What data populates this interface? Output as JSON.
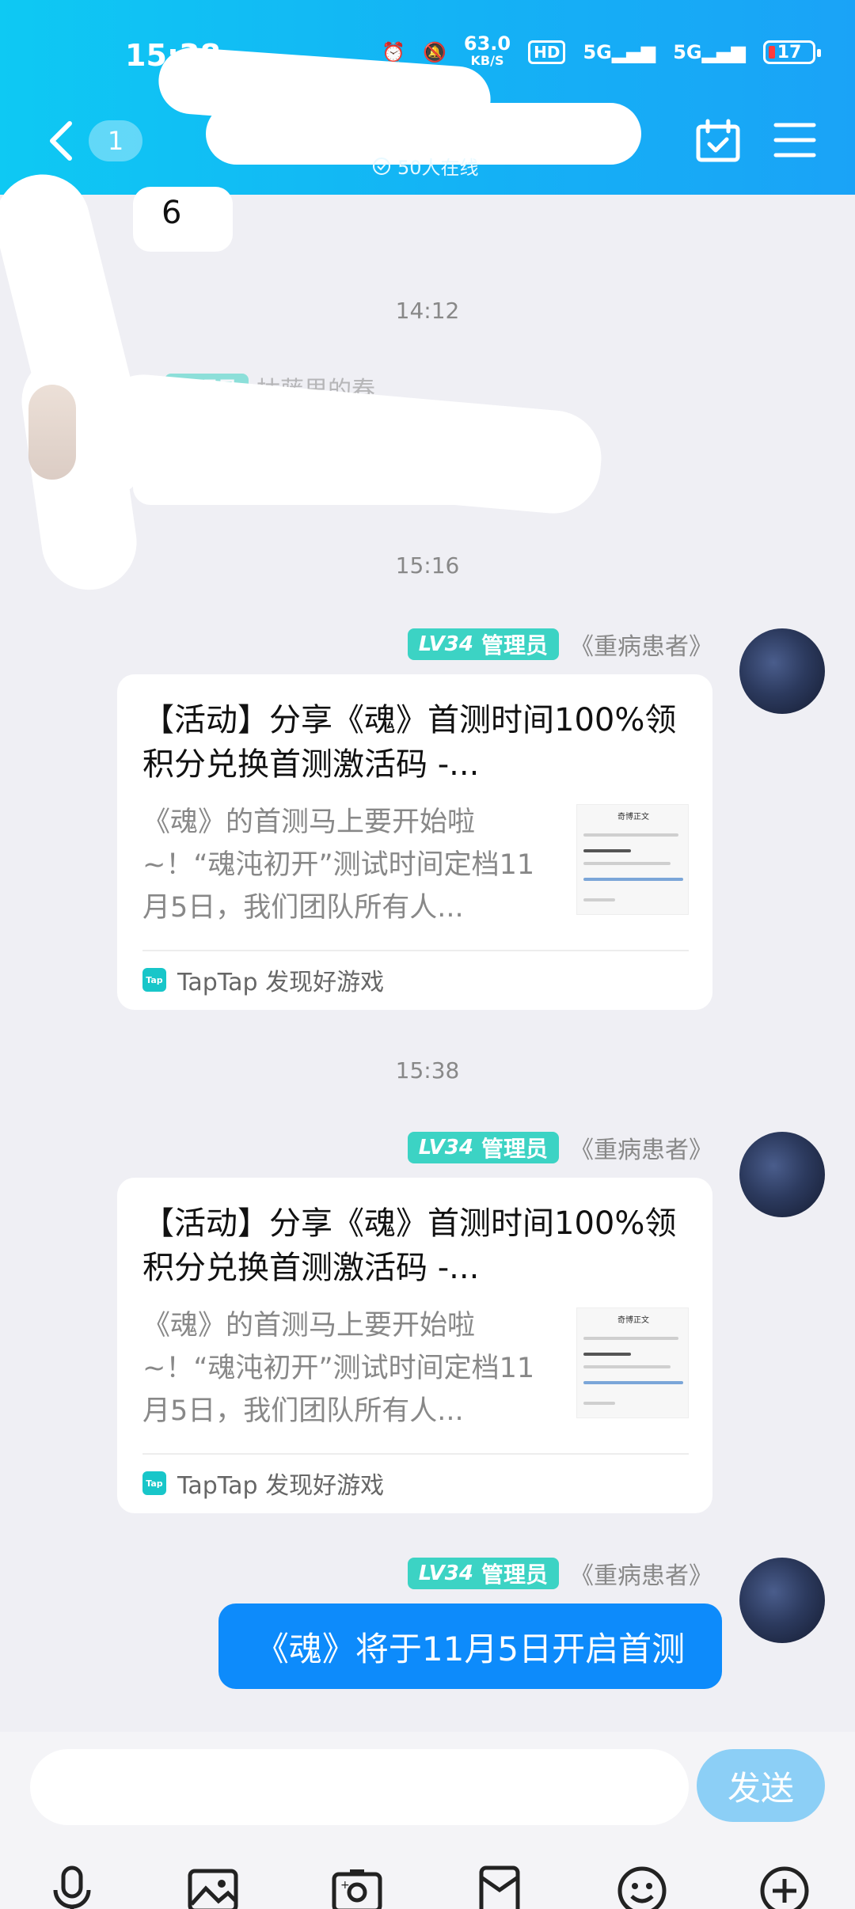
{
  "status_bar": {
    "time": "15:38",
    "speed_value": "63.0",
    "speed_unit": "KB/S",
    "hd": "HD",
    "net1": "5G",
    "net2": "5G",
    "battery": "17"
  },
  "header": {
    "unread_count": "1",
    "online_text": "50人在线"
  },
  "messages": {
    "prev_message_text": "6",
    "time_1": "14:12",
    "redacted_sender_badge": "管理员",
    "redacted_sender_name": "枯藤里的春",
    "time_2": "15:16",
    "time_3": "15:38",
    "sender_lv": "LV34",
    "sender_role": "管理员",
    "sender_name": "《重病患者》",
    "share_title": "【活动】分享《魂》首测时间100%领积分兑换首测激活码 -...",
    "share_desc": "《魂》的首测马上要开始啦~！“魂沌初开”测试时间定档11月5日，我们团队所有人...",
    "share_thumb_title": "奇博正文",
    "share_source": "TapTap 发现好游戏",
    "tap_logo_text": "Tap",
    "text_bubble": "《魂》将于11月5日开启首测"
  },
  "input_bar": {
    "placeholder": "",
    "send_label": "发送",
    "tools": [
      "microphone-icon",
      "image-icon",
      "camera-icon",
      "redpacket-icon",
      "emoji-icon",
      "plus-icon"
    ]
  }
}
